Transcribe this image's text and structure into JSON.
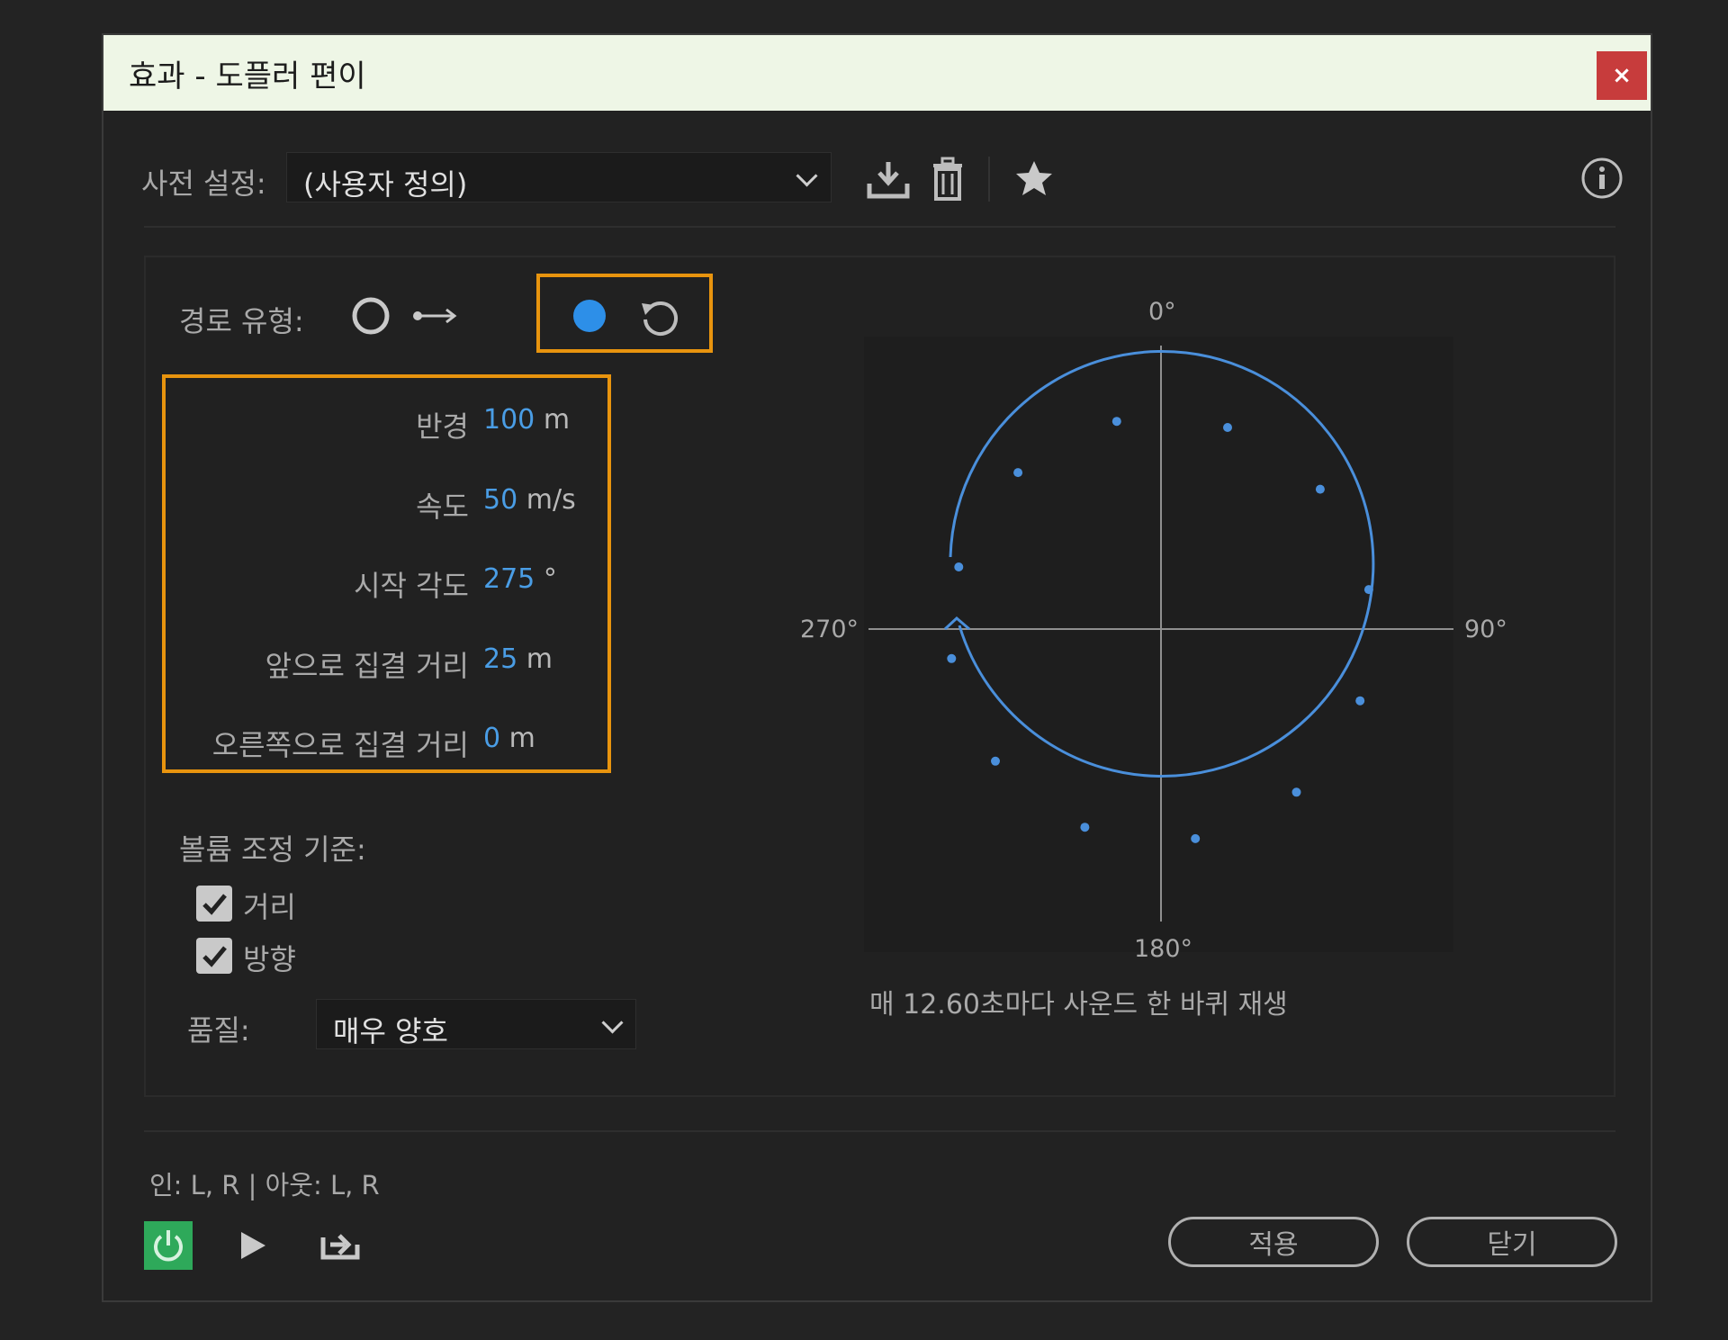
{
  "window": {
    "title": "효과 - 도플러 편이",
    "close_label": "×"
  },
  "preset": {
    "label": "사전 설정:",
    "value": "(사용자 정의)"
  },
  "path": {
    "label": "경로 유형:"
  },
  "params": {
    "radius": {
      "label": "반경",
      "value": "100",
      "unit": "m"
    },
    "speed": {
      "label": "속도",
      "value": "50",
      "unit": "m/s"
    },
    "start_angle": {
      "label": "시작 각도",
      "value": "275",
      "unit": "°"
    },
    "forward_offset": {
      "label": "앞으로 집결 거리",
      "value": "25",
      "unit": "m"
    },
    "right_offset": {
      "label": "오른쪽으로 집결 거리",
      "value": "0",
      "unit": "m"
    }
  },
  "volume": {
    "label": "볼륨 조정 기준:",
    "distance": {
      "label": "거리",
      "checked": true
    },
    "direction": {
      "label": "방향",
      "checked": true
    }
  },
  "quality": {
    "label": "품질:",
    "value": "매우 양호"
  },
  "plot": {
    "top": "0°",
    "right": "90°",
    "bottom": "180°",
    "left": "270°",
    "caption": "매 12.60초마다 사운드 한 바퀴 재생"
  },
  "io": "인: L, R | 아웃: L, R",
  "buttons": {
    "apply": "적용",
    "close": "닫기"
  },
  "colors": {
    "accent": "#4a9de5",
    "highlight": "#e8940e",
    "power": "#2ea95a",
    "close": "#c73c3c"
  },
  "icons": [
    "save-preset-icon",
    "delete-preset-icon",
    "favorite-star-icon",
    "info-icon",
    "circle-path-icon",
    "line-path-icon",
    "filled-circle-icon",
    "rotate-icon",
    "power-icon",
    "play-icon",
    "export-icon"
  ]
}
